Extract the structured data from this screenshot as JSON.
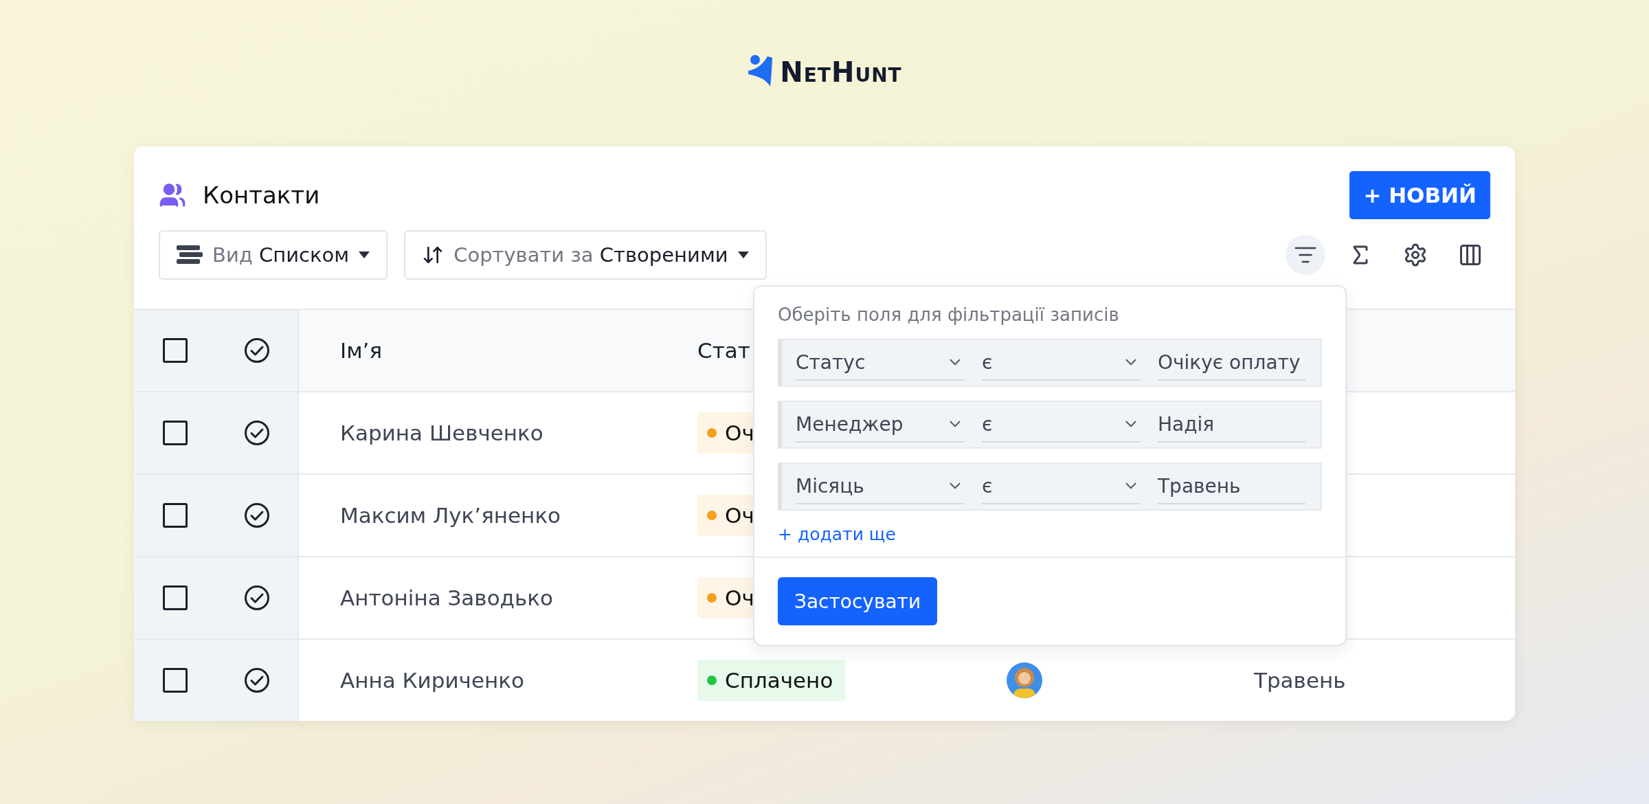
{
  "logo": {
    "text": "NetHunt"
  },
  "header": {
    "title": "Контакти",
    "new_button": "+ НОВИЙ"
  },
  "toolbar": {
    "view": {
      "label": "Вид",
      "value": "Списком"
    },
    "sort": {
      "label": "Сортувати за",
      "value": "Створеними"
    },
    "tools": [
      {
        "kind": "filter",
        "selected": true
      },
      {
        "kind": "sum",
        "selected": false
      },
      {
        "kind": "settings",
        "selected": false
      },
      {
        "kind": "columns",
        "selected": false
      }
    ]
  },
  "table": {
    "all_checked": false,
    "columns": [
      "Ім’я",
      "Стат"
    ],
    "rows": [
      {
        "checked": false,
        "name": "Карина Шевченко",
        "status": {
          "text": "Оч",
          "color": "#f5a01f"
        }
      },
      {
        "checked": false,
        "name": "Максим Лук’яненко",
        "status": {
          "text": "Оч",
          "color": "#f5a01f"
        }
      },
      {
        "checked": false,
        "name": "Антоніна Заводько",
        "status": {
          "text": "Оч",
          "color": "#f5a01f"
        }
      },
      {
        "checked": false,
        "name": "Анна Кириченко",
        "status": {
          "text": "Сплачено",
          "color": "#1fc744"
        },
        "month": "Травень"
      }
    ]
  },
  "filter_popover": {
    "hint": "Оберіть поля для фільтрації записів",
    "filters": [
      {
        "field": "Статус",
        "operator": "є",
        "value": "Очікує оплату"
      },
      {
        "field": "Менеджер",
        "operator": "є",
        "value": "Надія"
      },
      {
        "field": "Місяць",
        "operator": "є",
        "value": "Травень"
      }
    ],
    "add_link": "+ додати ще",
    "apply_button": "Застосувати"
  }
}
